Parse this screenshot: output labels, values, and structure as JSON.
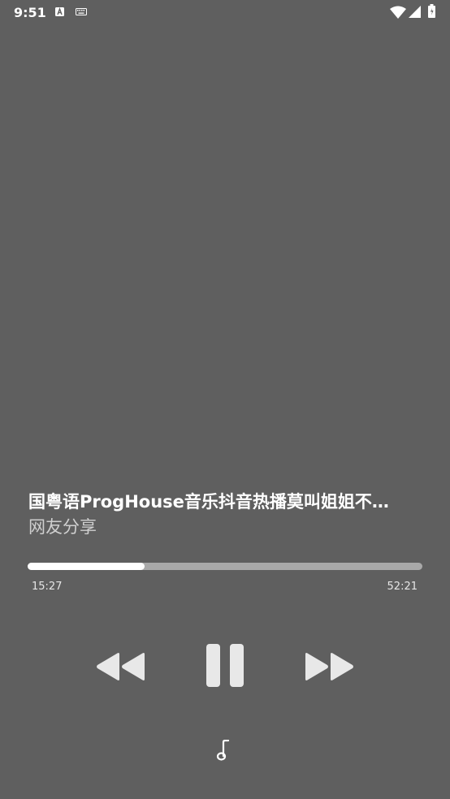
{
  "status_bar": {
    "time": "9:51",
    "icons": [
      "text-a-icon",
      "keyboard-icon",
      "wifi-icon",
      "signal-icon",
      "battery-icon"
    ]
  },
  "track": {
    "title": "国粤语ProgHouse音乐抖音热播莫叫姐姐不…",
    "artist": "网友分享"
  },
  "progress": {
    "elapsed": "15:27",
    "total": "52:21",
    "fraction": 0.2953
  },
  "controls": {
    "icons": [
      "rewind-icon",
      "pause-icon",
      "fast-forward-icon",
      "music-note-icon"
    ]
  },
  "colors": {
    "background": "#5f5f5f",
    "progress_fill": "#ffffff",
    "progress_track": "#a9a9a9",
    "control_icon": "#e8e8e8"
  }
}
